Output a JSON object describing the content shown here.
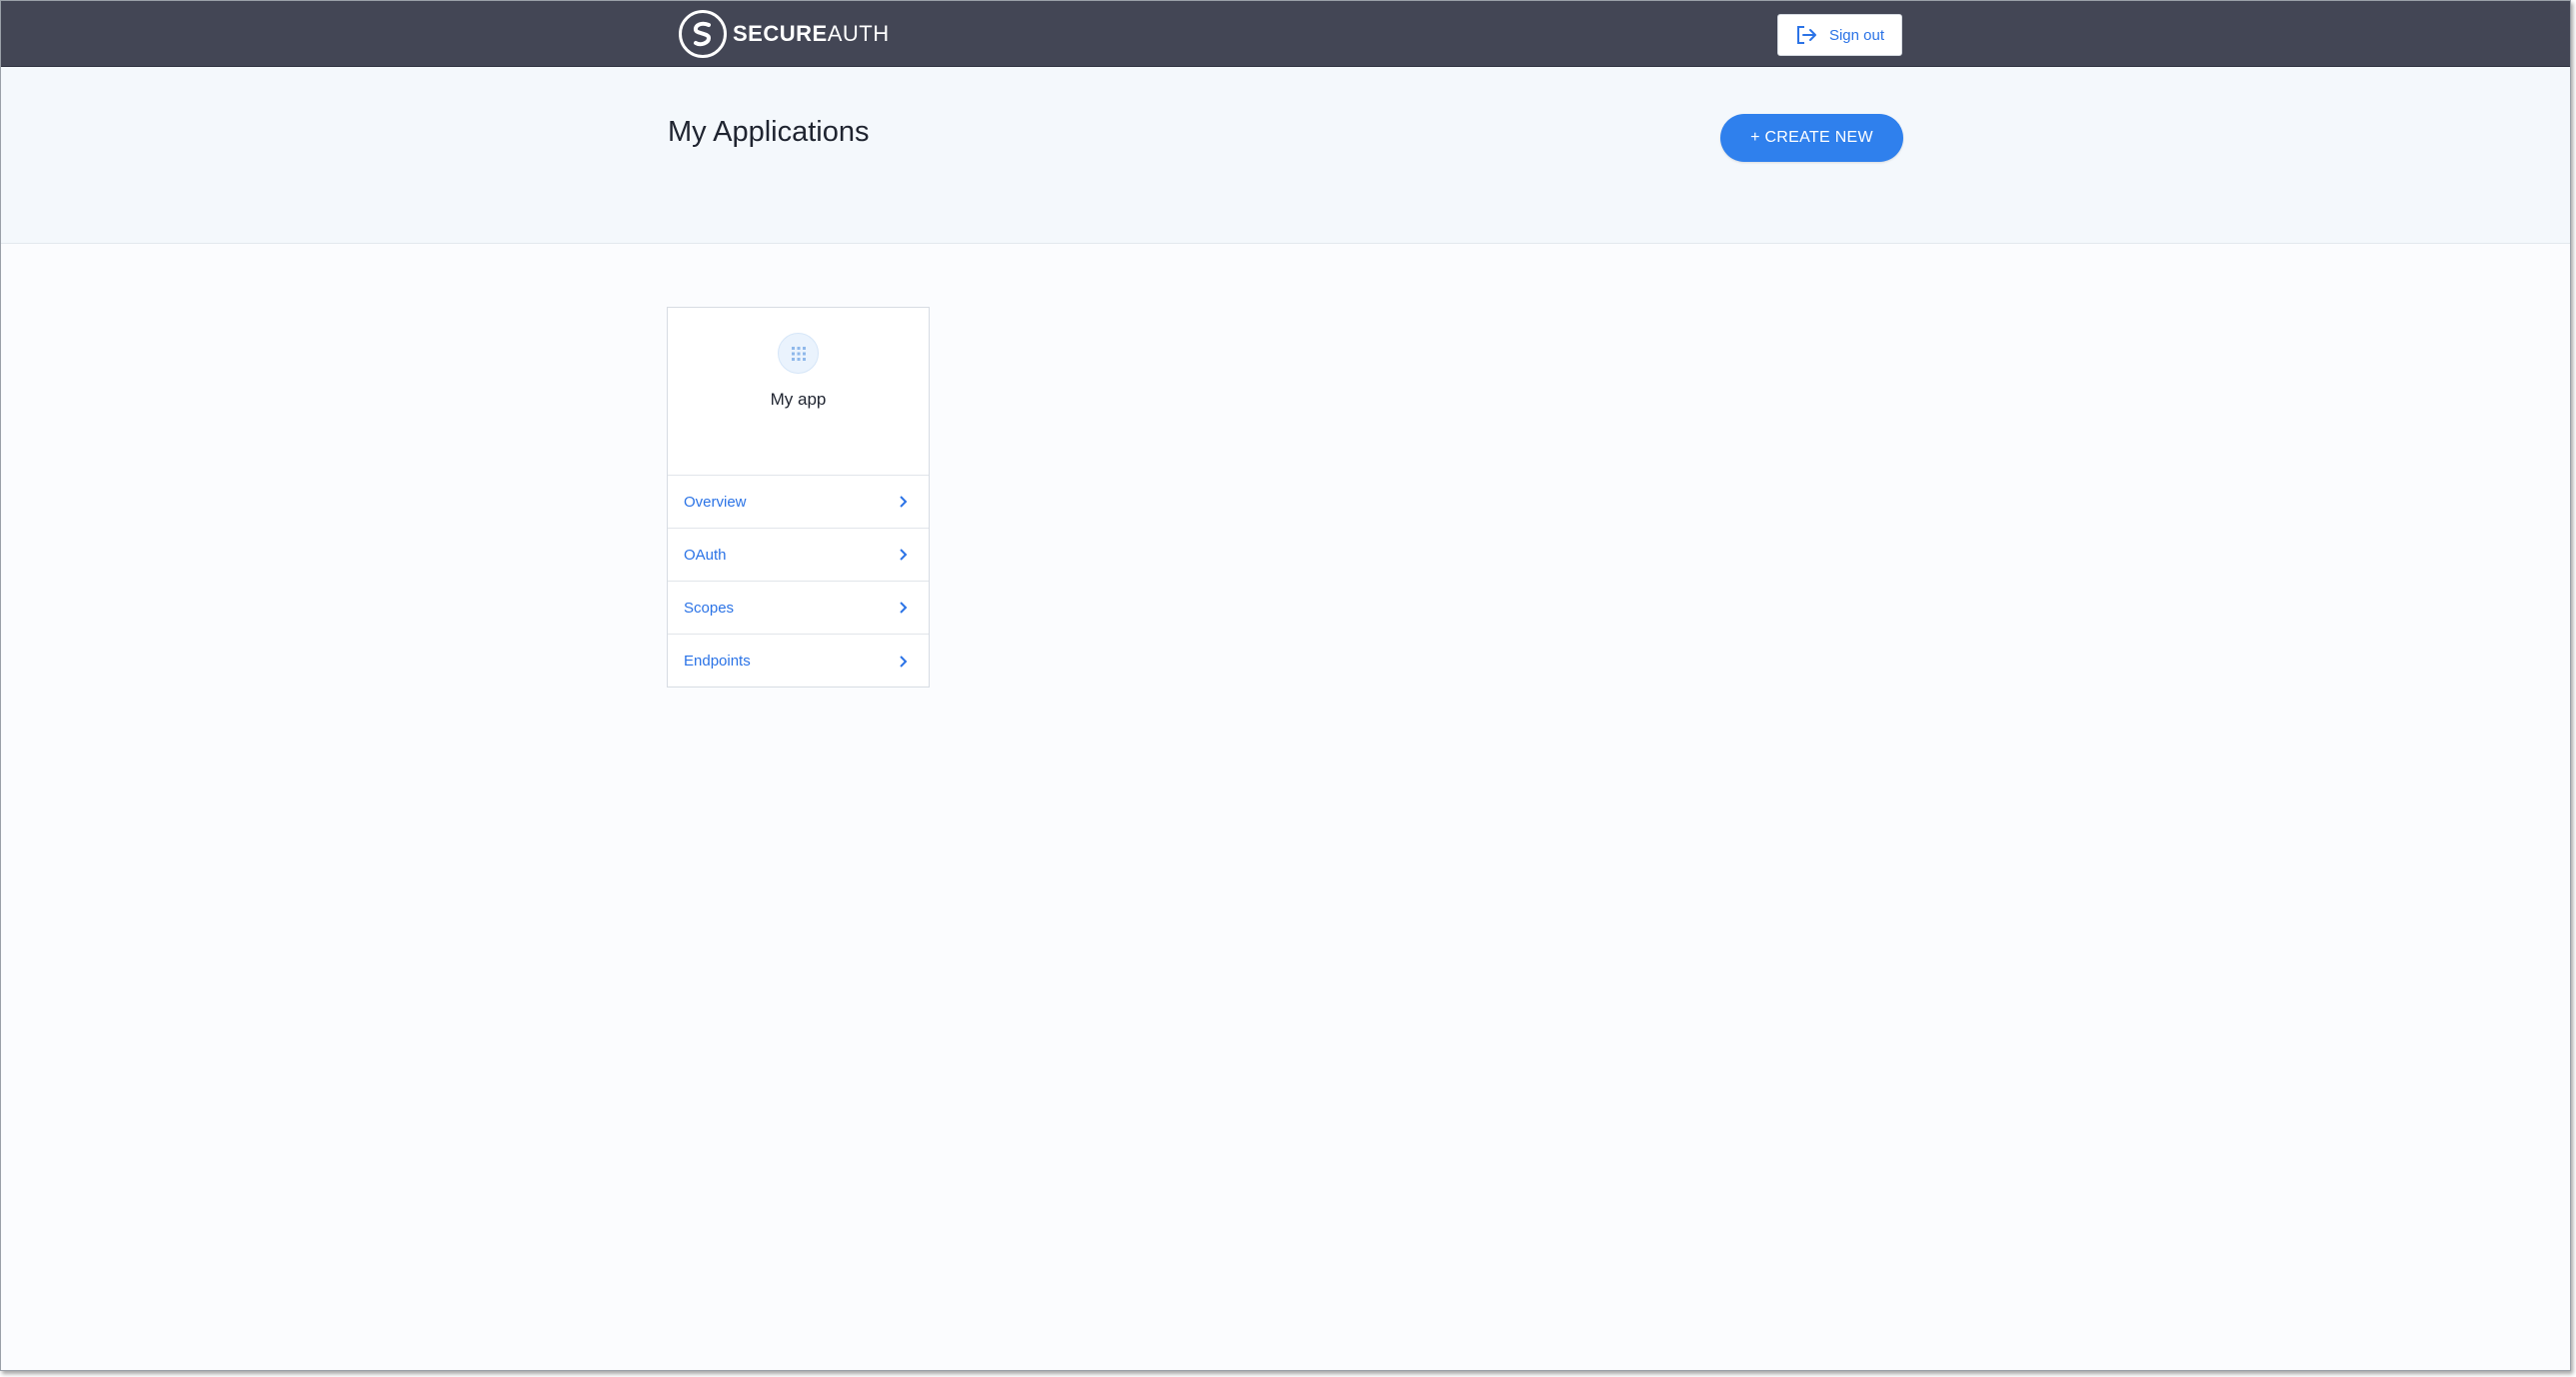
{
  "header": {
    "brand_bold": "SECURE",
    "brand_light": "AUTH",
    "signout_label": "Sign out"
  },
  "hero": {
    "title": "My Applications",
    "create_label": "+ CREATE NEW"
  },
  "app_card": {
    "name": "My app",
    "links": [
      {
        "label": "Overview"
      },
      {
        "label": "OAuth"
      },
      {
        "label": "Scopes"
      },
      {
        "label": "Endpoints"
      }
    ]
  },
  "icons": {
    "logo": "secureauth-logo-icon",
    "signout": "sign-out-icon",
    "app": "grid-icon",
    "link_arrow": "chevron-right-icon"
  },
  "colors": {
    "topbar": "#434655",
    "accent": "#2f80ed",
    "link": "#2b73e6",
    "hero_bg": "#f4f8fc"
  }
}
